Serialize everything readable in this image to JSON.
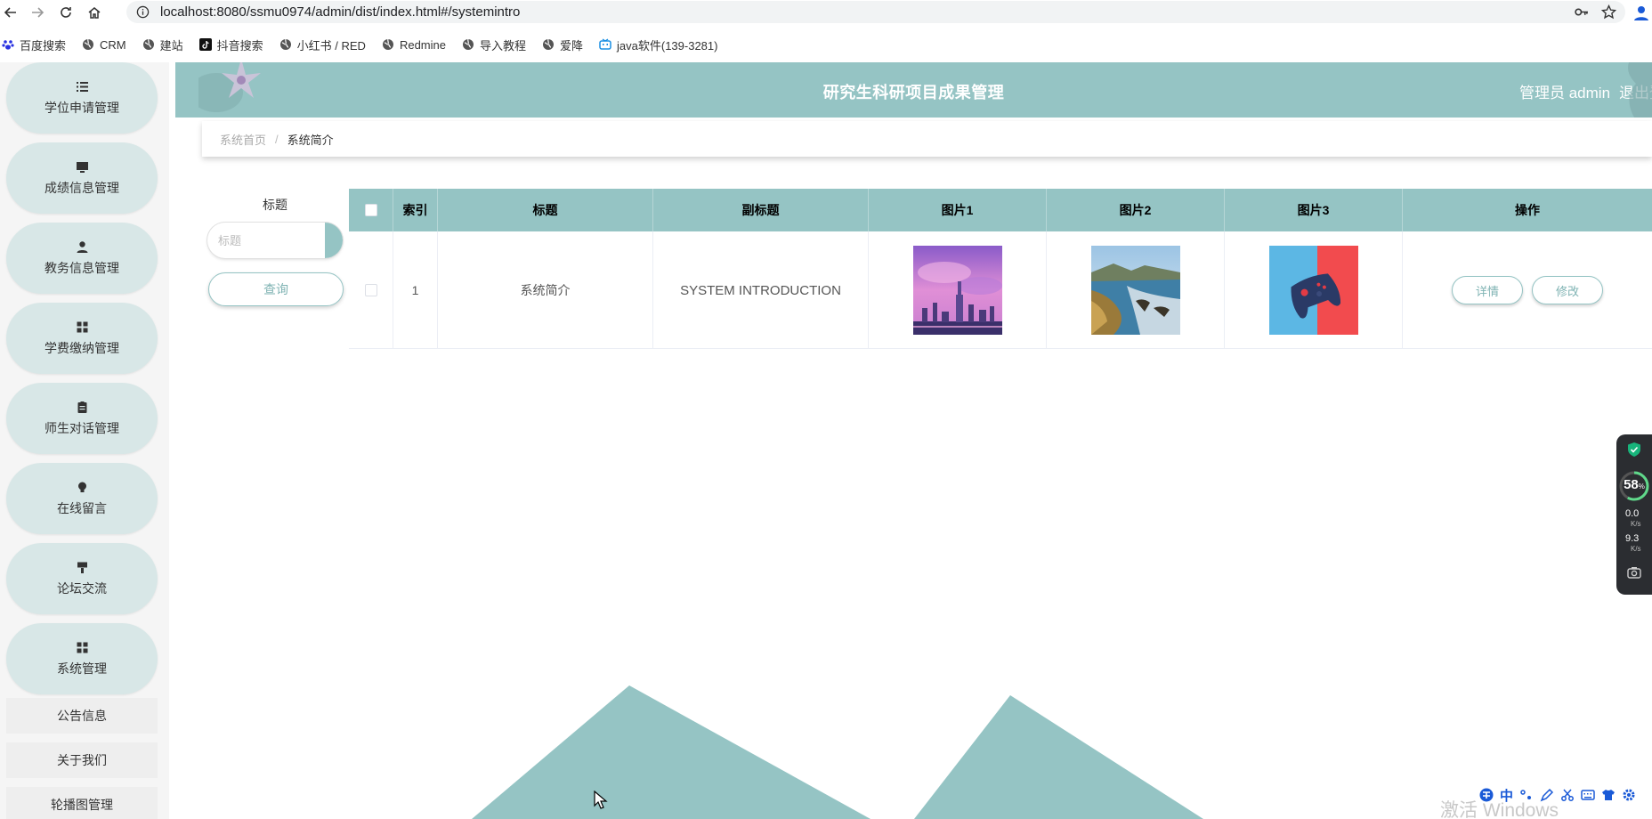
{
  "browser": {
    "url": "localhost:8080/ssmu0974/admin/dist/index.html#/systemintro",
    "bookmarks": [
      {
        "label": "百度搜索",
        "icon": "paw-icon"
      },
      {
        "label": "CRM",
        "icon": "globe-icon"
      },
      {
        "label": "建站",
        "icon": "globe-icon"
      },
      {
        "label": "抖音搜索",
        "icon": "tiktok-icon"
      },
      {
        "label": "小红书 / RED",
        "icon": "globe-icon"
      },
      {
        "label": "Redmine",
        "icon": "globe-icon"
      },
      {
        "label": "导入教程",
        "icon": "globe-icon"
      },
      {
        "label": "爱降",
        "icon": "globe-icon"
      },
      {
        "label": "java软件(139-3281)",
        "icon": "tv-icon"
      }
    ]
  },
  "sidebar": {
    "items": [
      {
        "label": "学位申请管理",
        "icon": "list-icon"
      },
      {
        "label": "成绩信息管理",
        "icon": "monitor-icon"
      },
      {
        "label": "教务信息管理",
        "icon": "user-icon"
      },
      {
        "label": "学费缴纳管理",
        "icon": "grid-icon"
      },
      {
        "label": "师生对话管理",
        "icon": "clipboard-icon"
      },
      {
        "label": "在线留言",
        "icon": "bulb-icon"
      },
      {
        "label": "论坛交流",
        "icon": "brush-icon"
      },
      {
        "label": "系统管理",
        "icon": "grid-icon"
      }
    ],
    "submenu": [
      "公告信息",
      "关于我们",
      "轮播图管理"
    ]
  },
  "header": {
    "title": "研究生科研项目成果管理",
    "user": "管理员 admin",
    "logout": "退出登"
  },
  "breadcrumb": {
    "home": "系统首页",
    "separator": "/",
    "current": "系统简介"
  },
  "search": {
    "label": "标题",
    "placeholder": "标题",
    "value": "",
    "query_button": "查询"
  },
  "table": {
    "columns": [
      "索引",
      "标题",
      "副标题",
      "图片1",
      "图片2",
      "图片3",
      "操作"
    ],
    "rows": [
      {
        "index": "1",
        "title": "系统简介",
        "subtitle": "SYSTEM INTRODUCTION",
        "images": [
          "city-skyline-thumbnail",
          "coastline-thumbnail",
          "gamepad-thumbnail"
        ]
      }
    ],
    "ops": {
      "detail": "详情",
      "edit": "修改"
    }
  },
  "widget": {
    "percent": "58",
    "percent_unit": "%",
    "upload_speed": "0.0",
    "download_speed": "9.3",
    "speed_unit": "K/s"
  },
  "watermark": "激活 Windows",
  "ime": {
    "zh": "中"
  },
  "colors": {
    "accent": "#95c4c4",
    "sidebar_item_bg": "#d8e7e7",
    "button_text": "#7fb3b3",
    "widget_bg": "#2b2d31"
  }
}
